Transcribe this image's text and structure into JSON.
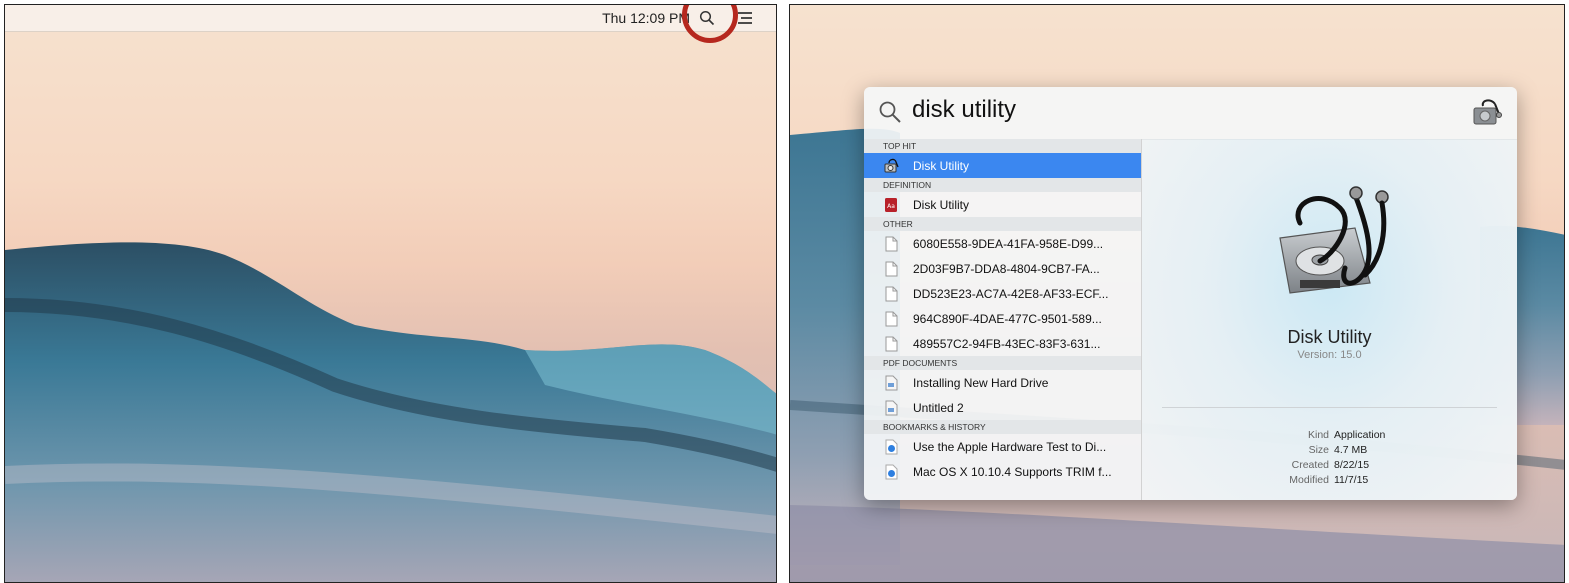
{
  "left": {
    "menubar": {
      "clock": "Thu 12:09 PM",
      "search_icon": "magnifier-icon",
      "menu_icon": "notification-list-icon",
      "highlight_color": "#b6281e"
    }
  },
  "spotlight": {
    "query": "disk utility",
    "sections": [
      {
        "header": "TOP HIT",
        "items": [
          {
            "label": "Disk Utility",
            "icon": "disk-utility-icon",
            "selected": true
          }
        ]
      },
      {
        "header": "DEFINITION",
        "items": [
          {
            "label": "Disk Utility",
            "icon": "dictionary-icon"
          }
        ]
      },
      {
        "header": "OTHER",
        "items": [
          {
            "label": "6080E558-9DEA-41FA-958E-D99...",
            "icon": "document-icon"
          },
          {
            "label": "2D03F9B7-DDA8-4804-9CB7-FA...",
            "icon": "document-icon"
          },
          {
            "label": "DD523E23-AC7A-42E8-AF33-ECF...",
            "icon": "document-icon"
          },
          {
            "label": "964C890F-4DAE-477C-9501-589...",
            "icon": "document-icon"
          },
          {
            "label": "489557C2-94FB-43EC-83F3-631...",
            "icon": "document-icon"
          }
        ]
      },
      {
        "header": "PDF DOCUMENTS",
        "items": [
          {
            "label": "Installing New Hard Drive",
            "icon": "pdf-icon"
          },
          {
            "label": "Untitled 2",
            "icon": "pdf-icon"
          }
        ]
      },
      {
        "header": "BOOKMARKS & HISTORY",
        "items": [
          {
            "label": "Use the Apple Hardware Test to Di...",
            "icon": "safari-bookmark-icon"
          },
          {
            "label": "Mac OS X 10.10.4 Supports TRIM f...",
            "icon": "safari-bookmark-icon"
          }
        ]
      }
    ],
    "preview": {
      "name": "Disk Utility",
      "version": "Version: 15.0",
      "meta": [
        {
          "k": "Kind",
          "v": "Application"
        },
        {
          "k": "Size",
          "v": "4.7 MB"
        },
        {
          "k": "Created",
          "v": "8/22/15"
        },
        {
          "k": "Modified",
          "v": "11/7/15"
        }
      ]
    },
    "selected_color": "#3b87f0"
  }
}
